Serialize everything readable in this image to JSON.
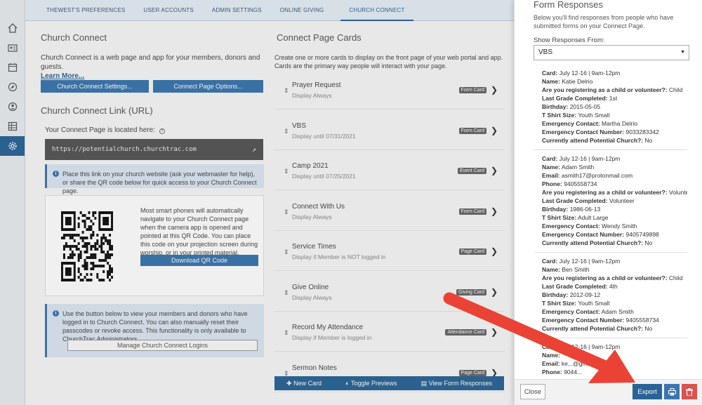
{
  "rail": {
    "items": [
      {
        "icon": "home-icon"
      },
      {
        "icon": "id-card-icon"
      },
      {
        "icon": "calendar-icon"
      },
      {
        "icon": "compass-icon"
      },
      {
        "icon": "contact-book-icon"
      },
      {
        "icon": "grid-icon"
      },
      {
        "icon": "gear-icon",
        "active": true
      }
    ]
  },
  "topnav": {
    "tabs": [
      "THEWEST'S PREFERENCES",
      "USER ACCOUNTS",
      "ADMIN SETTINGS",
      "ONLINE GIVING",
      "CHURCH CONNECT"
    ]
  },
  "church_connect": {
    "title": "Church Connect",
    "desc": "Church Connect is a web page and app for your members, donors and guests.",
    "learn_more": "Learn More...",
    "settings_btn": "Church Connect Settings...",
    "page_options_btn": "Connect Page Options..."
  },
  "link_section": {
    "title": "Church Connect Link (URL)",
    "located_label": "Your Connect Page is located here:",
    "url": "https://potentialchurch.churchtrac.com",
    "info": "Place this link on your church website (ask your webmaster for help), or share the QR code below for quick access to your Church Connect page.",
    "qr_text": "Most smart phones will automatically navigate to your Church Connect page when the camera app is opened and pointed at this QR Code. You can place this code on your projection screen during worship, or in your printed material.",
    "download_qr": "Download QR Code",
    "logins_info": "Use the button below to view your members and donors who have logged in to Church Connect. You can also manually reset their passcodes or revoke access. This functionality is only available to ChurchTrac Administrators.",
    "manage_logins": "Manage Church Connect Logins"
  },
  "cards_section": {
    "title": "Connect Page Cards",
    "desc": "Create one or more cards to display on the front page of your web portal and app. Cards are the primary way people will interact with your page.",
    "cards": [
      {
        "title": "Prayer Request",
        "sub": "Display Always",
        "badge": "Form Card"
      },
      {
        "title": "VBS",
        "sub": "Display until 07/31/2021",
        "badge": "Form Card"
      },
      {
        "title": "Camp 2021",
        "sub": "Display until 07/25/2021",
        "badge": "Event Card"
      },
      {
        "title": "Connect With Us",
        "sub": "Display Always",
        "badge": "Form Card"
      },
      {
        "title": "Service Times",
        "sub": "Display if Member is NOT logged in",
        "badge": "Page Card"
      },
      {
        "title": "Give Online",
        "sub": "Display Always",
        "badge": "Giving Card"
      },
      {
        "title": "Record My Attendance",
        "sub": "Display if Member is logged in",
        "badge": "Attendance Card"
      },
      {
        "title": "Sermon Notes",
        "sub": "",
        "badge": "Page Card"
      }
    ],
    "new_card": "New Card",
    "toggle_previews": "Toggle Previews",
    "view_responses": "View Form Responses"
  },
  "panel": {
    "title": "Form Responses",
    "desc": "Below you'll find responses from people who have submitted forms on your Connect Page.",
    "show_label": "Show Responses From:",
    "selected": "VBS",
    "responses": [
      [
        [
          "Card:",
          "July 12-16 | 9am-12pm"
        ],
        [
          "Name:",
          "Katie Delrio"
        ],
        [
          "Are you registering as a child or volunteer?:",
          "Child"
        ],
        [
          "Last Grade Completed:",
          "1st"
        ],
        [
          "Birthday:",
          "2015-05-05"
        ],
        [
          "T Shirt Size:",
          "Youth Small"
        ],
        [
          "Emergency Contact:",
          "Martha Delrio"
        ],
        [
          "Emergency Contact Number:",
          "9033283342"
        ],
        [
          "Currently attend Potential Church?:",
          "No"
        ]
      ],
      [
        [
          "Card:",
          "July 12-16 | 9am-12pm"
        ],
        [
          "Name:",
          "Adam Smith"
        ],
        [
          "Email:",
          "asmith17@protonmail.com"
        ],
        [
          "Phone:",
          "9405558734"
        ],
        [
          "Are you registering as a child or volunteer?:",
          "Volunteer"
        ],
        [
          "Last Grade Completed:",
          "Volunteer"
        ],
        [
          "Birthday:",
          "1986-06-13"
        ],
        [
          "T Shirt Size:",
          "Adult Large"
        ],
        [
          "Emergency Contact:",
          "Wendy Smith"
        ],
        [
          "Emergency Contact Number:",
          "9405749898"
        ],
        [
          "Currently attend Potential Church?:",
          "No"
        ]
      ],
      [
        [
          "Card:",
          "July 12-16 | 9am-12pm"
        ],
        [
          "Name:",
          "Ben Smith"
        ],
        [
          "Are you registering as a child or volunteer?:",
          "Child"
        ],
        [
          "Last Grade Completed:",
          "4th"
        ],
        [
          "Birthday:",
          "2012-09-12"
        ],
        [
          "T Shirt Size:",
          "Youth Small"
        ],
        [
          "Emergency Contact:",
          "Adam Smith"
        ],
        [
          "Emergency Contact Number:",
          "9405558734"
        ],
        [
          "Currently attend Potential Church?:",
          "No"
        ]
      ],
      [
        [
          "Card:",
          "July 12-16 | 9am-12pm"
        ],
        [
          "Name:",
          ""
        ],
        [
          "Email:",
          "ke...@gmail.com"
        ],
        [
          "Phone:",
          "9044..."
        ]
      ]
    ],
    "close": "Close",
    "export": "Export"
  },
  "colors": {
    "brand": "#2a6496",
    "arrow": "#ea4335",
    "delete": "#d9534f"
  }
}
